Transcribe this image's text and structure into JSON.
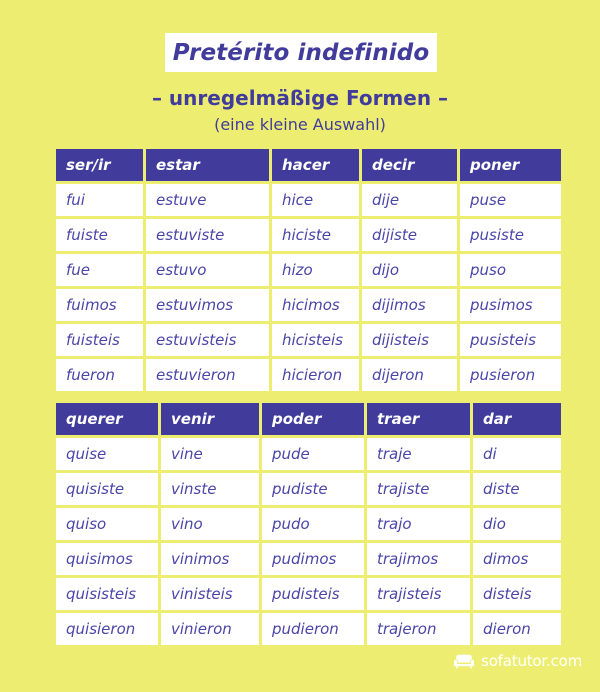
{
  "title": "Pretérito indefinido",
  "subtitle": "– unregelmäßige Formen –",
  "subsubtitle": "(eine kleine Auswahl)",
  "colors": {
    "background": "#EDEE71",
    "header_purple": "#413C9B",
    "cell_text": "#4A45A8",
    "banner": "#FFFFFF"
  },
  "tables": [
    {
      "headers": [
        "ser/ir",
        "estar",
        "hacer",
        "decir",
        "poner"
      ],
      "rows": [
        [
          "fui",
          "estuve",
          "hice",
          "dije",
          "puse"
        ],
        [
          "fuiste",
          "estuviste",
          "hiciste",
          "dijiste",
          "pusiste"
        ],
        [
          "fue",
          "estuvo",
          "hizo",
          "dijo",
          "puso"
        ],
        [
          "fuimos",
          "estuvimos",
          "hicimos",
          "dijimos",
          "pusimos"
        ],
        [
          "fuisteis",
          "estuvisteis",
          "hicisteis",
          "dijisteis",
          "pusisteis"
        ],
        [
          "fueron",
          "estuvieron",
          "hicieron",
          "dijeron",
          "pusieron"
        ]
      ]
    },
    {
      "headers": [
        "querer",
        "venir",
        "poder",
        "traer",
        "dar"
      ],
      "rows": [
        [
          "quise",
          "vine",
          "pude",
          "traje",
          "di"
        ],
        [
          "quisiste",
          "vinste",
          "pudiste",
          "trajiste",
          "diste"
        ],
        [
          "quiso",
          "vino",
          "pudo",
          "trajo",
          "dio"
        ],
        [
          "quisimos",
          "vinimos",
          "pudimos",
          "trajimos",
          "dimos"
        ],
        [
          "quisisteis",
          "vinisteis",
          "pudisteis",
          "trajisteis",
          "disteis"
        ],
        [
          "quisieron",
          "vinieron",
          "pudieron",
          "trajeron",
          "dieron"
        ]
      ]
    }
  ],
  "footer": {
    "brand": "sofatutor.com",
    "icon": "sofa-icon"
  }
}
